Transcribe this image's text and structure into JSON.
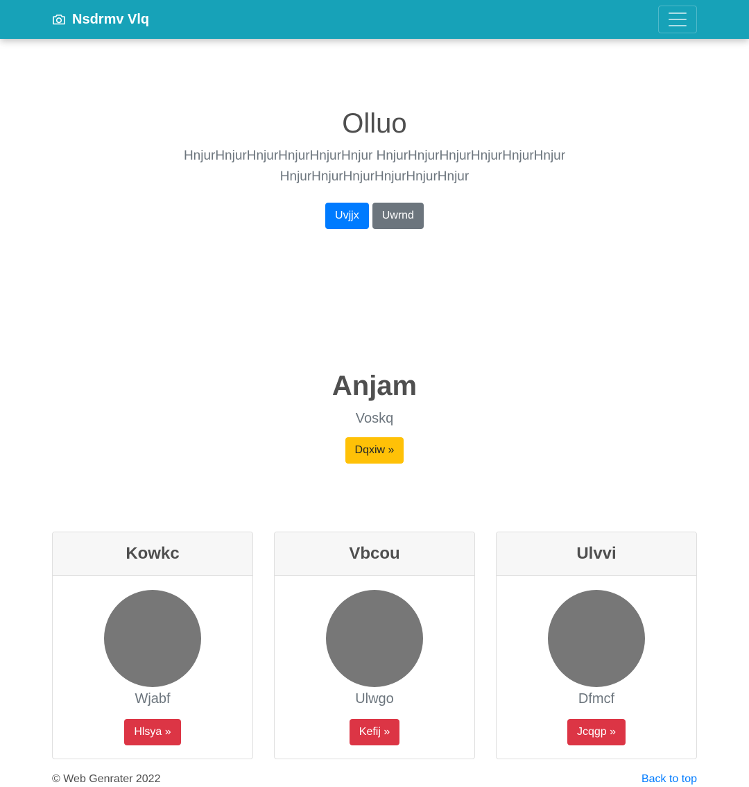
{
  "navbar": {
    "brand": "Nsdrmv Vlq",
    "brand_icon": "camera-icon",
    "toggler_icon": "hamburger-menu-icon",
    "color": "#17a2b8"
  },
  "hero": {
    "title": "Olluo",
    "lead": "HnjurHnjurHnjurHnjurHnjurHnjur HnjurHnjurHnjurHnjurHnjurHnjur HnjurHnjurHnjurHnjurHnjurHnjur",
    "primary_label": "Uvjjx",
    "secondary_label": "Uwrnd"
  },
  "feature": {
    "title": "Anjam",
    "subtitle": "Voskq",
    "button_label": "Dqxiw »"
  },
  "cards": [
    {
      "title": "Kowkc",
      "text": "Wjabf",
      "button_label": "Hlsya »"
    },
    {
      "title": "Vbcou",
      "text": "Ulwgo",
      "button_label": "Kefij »"
    },
    {
      "title": "Ulvvi",
      "text": "Dfmcf",
      "button_label": "Jcqgp »"
    }
  ],
  "footer": {
    "copyright": "© Web Genrater 2022",
    "back_to_top": "Back to top"
  },
  "colors": {
    "primary": "#007bff",
    "secondary": "#6c757d",
    "warning": "#ffc107",
    "danger": "#dc3545",
    "avatar": "#777777"
  }
}
